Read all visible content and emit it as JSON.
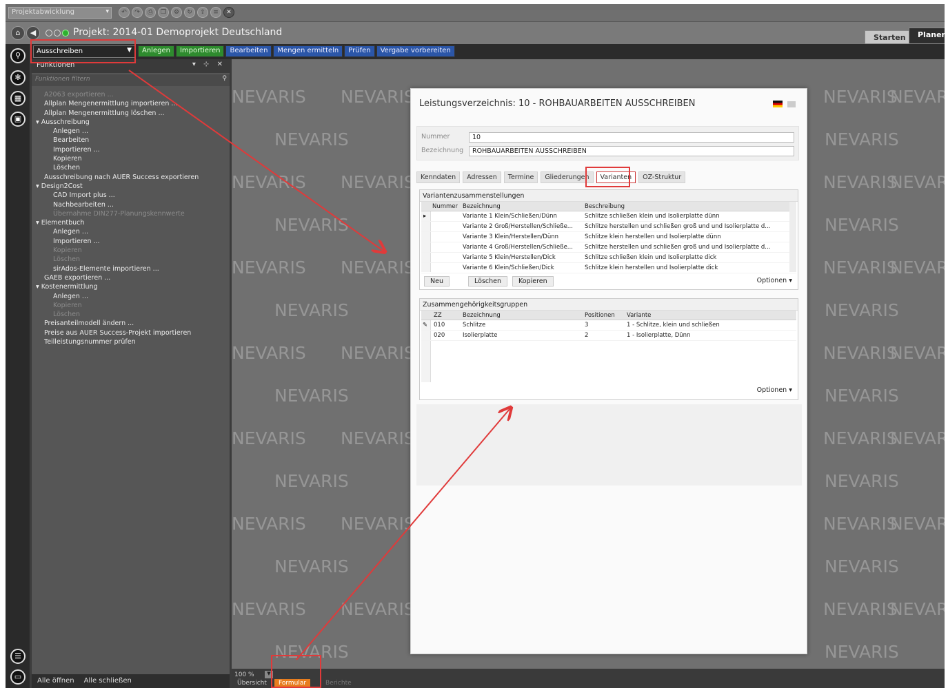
{
  "topbar": {
    "project_select": "Projektabwicklung"
  },
  "titlebar": {
    "title": "Projekt: 2014-01 Demoprojekt Deutschland",
    "modes": [
      "Starten",
      "Planen"
    ]
  },
  "toolbar": {
    "function_select": "Ausschreiben",
    "buttons": [
      {
        "label": "Anlegen",
        "color": "green"
      },
      {
        "label": "Importieren",
        "color": "green"
      },
      {
        "label": "Bearbeiten",
        "color": "blue"
      },
      {
        "label": "Mengen ermitteln",
        "color": "blue"
      },
      {
        "label": "Prüfen",
        "color": "blue"
      },
      {
        "label": "Vergabe vorbereiten",
        "color": "blue"
      }
    ]
  },
  "functions_panel": {
    "title": "Funktionen",
    "filter_placeholder": "Funktionen filtern",
    "items": [
      {
        "label": "A2063 exportieren ...",
        "level": 1,
        "disabled": true
      },
      {
        "label": "Allplan Mengenermittlung importieren ...",
        "level": 1
      },
      {
        "label": "Allplan Mengenermittlung löschen ...",
        "level": 1
      },
      {
        "label": "Ausschreibung",
        "level": 0,
        "group": true
      },
      {
        "label": "Anlegen ...",
        "level": 2
      },
      {
        "label": "Bearbeiten",
        "level": 2
      },
      {
        "label": "Importieren ...",
        "level": 2
      },
      {
        "label": "Kopieren",
        "level": 2
      },
      {
        "label": "Löschen",
        "level": 2
      },
      {
        "label": "Ausschreibung nach AUER Success exportieren",
        "level": 1
      },
      {
        "label": "Design2Cost",
        "level": 0,
        "group": true
      },
      {
        "label": "CAD Import plus ...",
        "level": 2
      },
      {
        "label": "Nachbearbeiten ...",
        "level": 2
      },
      {
        "label": "Übernahme DIN277-Planungskennwerte",
        "level": 2,
        "disabled": true
      },
      {
        "label": "Elementbuch",
        "level": 0,
        "group": true
      },
      {
        "label": "Anlegen ...",
        "level": 2
      },
      {
        "label": "Importieren ...",
        "level": 2
      },
      {
        "label": "Kopieren",
        "level": 2,
        "disabled": true
      },
      {
        "label": "Löschen",
        "level": 2,
        "disabled": true
      },
      {
        "label": "sirAdos-Elemente importieren ...",
        "level": 2
      },
      {
        "label": "GAEB exportieren ...",
        "level": 1
      },
      {
        "label": "Kostenermittlung",
        "level": 0,
        "group": true
      },
      {
        "label": "Anlegen ...",
        "level": 2
      },
      {
        "label": "Kopieren",
        "level": 2,
        "disabled": true
      },
      {
        "label": "Löschen",
        "level": 2,
        "disabled": true
      },
      {
        "label": "Preisanteilmodell ändern ...",
        "level": 1
      },
      {
        "label": "Preise aus AUER Success-Projekt importieren",
        "level": 1
      },
      {
        "label": "Teilleistungsnummer prüfen",
        "level": 1
      }
    ],
    "footer": [
      "Alle öffnen",
      "Alle schließen"
    ]
  },
  "watermark": "NEVARIS",
  "view": {
    "zoom": "100 %",
    "tabs": [
      "Übersicht",
      "Formular",
      "Berichte"
    ],
    "active_tab": "Formular"
  },
  "document": {
    "title": "Leistungsverzeichnis: 10 - ROHBAUARBEITEN AUSSCHREIBEN",
    "fields": {
      "nummer_label": "Nummer",
      "nummer_value": "10",
      "bezeichnung_label": "Bezeichnung",
      "bezeichnung_value": "ROHBAUARBEITEN AUSSCHREIBEN"
    },
    "tabs": [
      "Kenndaten",
      "Adressen",
      "Termine",
      "Gliederungen",
      "Varianten",
      "OZ-Struktur"
    ],
    "active_tab": "Varianten",
    "variants": {
      "title": "Variantenzusammenstellungen",
      "columns": [
        "Nummer",
        "Bezeichnung",
        "Beschreibung"
      ],
      "rows": [
        {
          "bez": "Variante 1 Klein/Schließen/Dünn",
          "desc": "Schlitze schließen klein und Isolierplatte dünn"
        },
        {
          "bez": "Variante 2 Groß/Herstellen/Schließe...",
          "desc": "Schlitze herstellen und schließen groß und und Isolierplatte d..."
        },
        {
          "bez": "Variante 3 Klein/Herstellen/Dünn",
          "desc": "Schlitze klein herstellen und Isolierplatte dünn"
        },
        {
          "bez": "Variante 4 Groß/Herstellen/Schließe...",
          "desc": "Schlitze herstellen und schließen groß und und Isolierplatte d..."
        },
        {
          "bez": "Variante 5 Klein/Herstellen/Dick",
          "desc": "Schlitze schließen klein und Isolierplatte dick"
        },
        {
          "bez": "Variante 6 Klein/Schließen/Dick",
          "desc": "Schlitze klein herstellen und Isolierplatte dick"
        }
      ],
      "buttons": [
        "Neu",
        "Löschen",
        "Kopieren"
      ],
      "options": "Optionen"
    },
    "groups": {
      "title": "Zusammengehörigkeitsgruppen",
      "columns": [
        "ZZ",
        "Bezeichnung",
        "Positionen",
        "Variante"
      ],
      "rows": [
        {
          "zz": "010",
          "bez": "Schlitze",
          "pos": "3",
          "var": "1 - Schlitze,  klein und schließen"
        },
        {
          "zz": "020",
          "bez": "Isolierplatte",
          "pos": "2",
          "var": "1 - Isolierplatte, Dünn"
        }
      ],
      "options": "Optionen"
    }
  },
  "colors": {
    "highlight": "#e03a3a",
    "accent": "#e87d1e"
  }
}
